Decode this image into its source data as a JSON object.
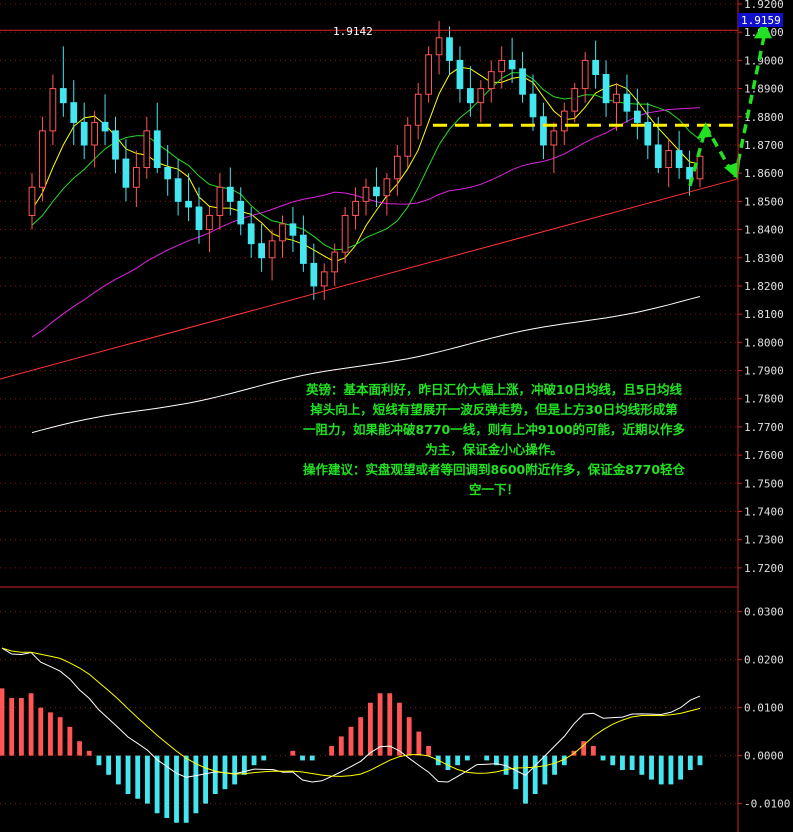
{
  "chart_data": [
    {
      "type": "candlestick",
      "instrument": "英镑",
      "current_price": "1.9159",
      "peak_label": "1.9142",
      "ylim": [
        1.715,
        1.92
      ],
      "y_ticks": [
        "1.9200",
        "1.9100",
        "1.9000",
        "1.8900",
        "1.8800",
        "1.8700",
        "1.8600",
        "1.8500",
        "1.8400",
        "1.8300",
        "1.8200",
        "1.8100",
        "1.8000",
        "1.7900",
        "1.7800",
        "1.7700",
        "1.7600",
        "1.7500",
        "1.7400",
        "1.7300",
        "1.7200"
      ],
      "y_tick_values": [
        1.92,
        1.91,
        1.9,
        1.89,
        1.88,
        1.87,
        1.86,
        1.85,
        1.84,
        1.83,
        1.82,
        1.81,
        1.8,
        1.79,
        1.78,
        1.77,
        1.76,
        1.75,
        1.74,
        1.73,
        1.72
      ],
      "candles": [
        [
          1.845,
          1.86,
          1.84,
          1.855
        ],
        [
          1.855,
          1.88,
          1.85,
          1.875
        ],
        [
          1.875,
          1.895,
          1.87,
          1.89
        ],
        [
          1.89,
          1.905,
          1.88,
          1.885
        ],
        [
          1.885,
          1.893,
          1.87,
          1.878
        ],
        [
          1.878,
          1.885,
          1.865,
          1.87
        ],
        [
          1.87,
          1.882,
          1.862,
          1.878
        ],
        [
          1.878,
          1.888,
          1.87,
          1.875
        ],
        [
          1.875,
          1.88,
          1.86,
          1.865
        ],
        [
          1.865,
          1.872,
          1.85,
          1.855
        ],
        [
          1.855,
          1.868,
          1.848,
          1.862
        ],
        [
          1.862,
          1.88,
          1.858,
          1.875
        ],
        [
          1.875,
          1.885,
          1.86,
          1.862
        ],
        [
          1.862,
          1.87,
          1.852,
          1.858
        ],
        [
          1.858,
          1.865,
          1.845,
          1.85
        ],
        [
          1.85,
          1.86,
          1.843,
          1.848
        ],
        [
          1.848,
          1.855,
          1.835,
          1.84
        ],
        [
          1.84,
          1.848,
          1.832,
          1.845
        ],
        [
          1.845,
          1.86,
          1.84,
          1.855
        ],
        [
          1.855,
          1.862,
          1.845,
          1.85
        ],
        [
          1.85,
          1.855,
          1.838,
          1.842
        ],
        [
          1.842,
          1.848,
          1.83,
          1.835
        ],
        [
          1.835,
          1.842,
          1.825,
          1.83
        ],
        [
          1.83,
          1.84,
          1.822,
          1.836
        ],
        [
          1.836,
          1.845,
          1.83,
          1.842
        ],
        [
          1.842,
          1.848,
          1.832,
          1.838
        ],
        [
          1.838,
          1.845,
          1.825,
          1.828
        ],
        [
          1.828,
          1.835,
          1.815,
          1.82
        ],
        [
          1.82,
          1.828,
          1.815,
          1.825
        ],
        [
          1.825,
          1.835,
          1.82,
          1.832
        ],
        [
          1.832,
          1.848,
          1.828,
          1.845
        ],
        [
          1.845,
          1.855,
          1.84,
          1.85
        ],
        [
          1.85,
          1.858,
          1.845,
          1.855
        ],
        [
          1.855,
          1.862,
          1.848,
          1.852
        ],
        [
          1.852,
          1.86,
          1.845,
          1.858
        ],
        [
          1.858,
          1.87,
          1.852,
          1.866
        ],
        [
          1.866,
          1.88,
          1.862,
          1.877
        ],
        [
          1.877,
          1.892,
          1.872,
          1.888
        ],
        [
          1.888,
          1.905,
          1.885,
          1.902
        ],
        [
          1.902,
          1.914,
          1.895,
          1.908
        ],
        [
          1.908,
          1.912,
          1.895,
          1.9
        ],
        [
          1.9,
          1.905,
          1.885,
          1.89
        ],
        [
          1.89,
          1.898,
          1.88,
          1.885
        ],
        [
          1.885,
          1.893,
          1.878,
          1.89
        ],
        [
          1.89,
          1.9,
          1.885,
          1.896
        ],
        [
          1.896,
          1.905,
          1.89,
          1.9
        ],
        [
          1.9,
          1.908,
          1.892,
          1.897
        ],
        [
          1.897,
          1.903,
          1.885,
          1.888
        ],
        [
          1.888,
          1.895,
          1.875,
          1.88
        ],
        [
          1.88,
          1.885,
          1.865,
          1.87
        ],
        [
          1.87,
          1.878,
          1.86,
          1.875
        ],
        [
          1.875,
          1.885,
          1.87,
          1.882
        ],
        [
          1.882,
          1.892,
          1.878,
          1.89
        ],
        [
          1.89,
          1.903,
          1.885,
          1.9
        ],
        [
          1.9,
          1.907,
          1.89,
          1.895
        ],
        [
          1.895,
          1.9,
          1.88,
          1.885
        ],
        [
          1.885,
          1.892,
          1.875,
          1.888
        ],
        [
          1.888,
          1.895,
          1.878,
          1.882
        ],
        [
          1.882,
          1.89,
          1.872,
          1.878
        ],
        [
          1.878,
          1.885,
          1.865,
          1.87
        ],
        [
          1.87,
          1.88,
          1.86,
          1.862
        ],
        [
          1.862,
          1.872,
          1.855,
          1.868
        ],
        [
          1.868,
          1.875,
          1.858,
          1.862
        ],
        [
          1.862,
          1.868,
          1.852,
          1.858
        ],
        [
          1.858,
          1.868,
          1.855,
          1.866
        ]
      ],
      "series": [
        {
          "name": "MA5",
          "color": "#ffff00"
        },
        {
          "name": "MA10",
          "color": "#22dd22"
        },
        {
          "name": "MA30",
          "color": "#dd22dd"
        },
        {
          "name": "MA200",
          "color": "#ffffff"
        }
      ],
      "annotation_lines": [
        "英镑：基本面利好，昨日汇价大幅上涨，冲破10日均线，且5日均线",
        "掉头向上，短线有望展开一波反弹走势，但是上方30日均线形成第",
        "一阻力，如果能冲破8770一线，则有上冲9100的可能，近期以作多",
        "为主，保证金小心操作。",
        "操作建议：实盘观望或者等回调到8600附近作多，保证金8770轻仓",
        "空一下！"
      ],
      "colors": {
        "up": "#ff5555",
        "down": "#44e6f0",
        "resistance": "#ffee00",
        "trend": "#ff3333",
        "arrow": "#22e022"
      }
    },
    {
      "type": "macd",
      "ylim": [
        -0.0155,
        0.0345
      ],
      "y_ticks": [
        "0.0300",
        "0.0200",
        "0.0100",
        "0.0000",
        "-0.0100"
      ],
      "y_tick_values": [
        0.03,
        0.02,
        0.01,
        0.0,
        -0.01
      ],
      "histogram": [
        0.014,
        0.012,
        0.012,
        0.013,
        0.01,
        0.009,
        0.008,
        0.006,
        0.003,
        0.001,
        -0.002,
        -0.004,
        -0.006,
        -0.008,
        -0.009,
        -0.01,
        -0.012,
        -0.013,
        -0.014,
        -0.014,
        -0.012,
        -0.01,
        -0.008,
        -0.007,
        -0.006,
        -0.004,
        -0.002,
        -0.001,
        0.0,
        0.0,
        0.001,
        -0.001,
        -0.001,
        0.0,
        0.002,
        0.004,
        0.006,
        0.008,
        0.011,
        0.013,
        0.013,
        0.011,
        0.008,
        0.005,
        0.002,
        -0.002,
        -0.003,
        -0.002,
        -0.001,
        0.0,
        -0.001,
        -0.002,
        -0.004,
        -0.007,
        -0.01,
        -0.008,
        -0.006,
        -0.004,
        -0.002,
        0.001,
        0.003,
        0.002,
        -0.001,
        -0.002,
        -0.003,
        -0.003,
        -0.004,
        -0.005,
        -0.006,
        -0.006,
        -0.005,
        -0.003,
        -0.002
      ],
      "series": [
        {
          "name": "DIF",
          "color": "#ffffff"
        },
        {
          "name": "DEA",
          "color": "#ffff00"
        }
      ]
    }
  ]
}
